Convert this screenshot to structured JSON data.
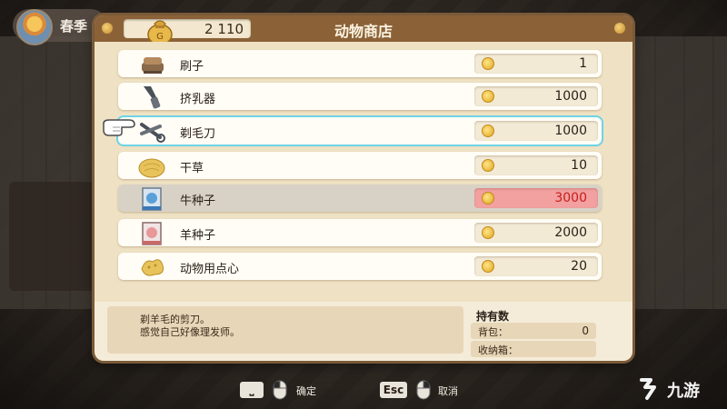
{
  "hud": {
    "season": "春季"
  },
  "shop": {
    "title": "动物商店",
    "money": "2 110",
    "items": [
      {
        "name": "刷子",
        "price": "1",
        "icon": "brush-icon"
      },
      {
        "name": "挤乳器",
        "price": "1000",
        "icon": "milker-icon"
      },
      {
        "name": "剃毛刀",
        "price": "1000",
        "icon": "shears-icon"
      },
      {
        "name": "干草",
        "price": "10",
        "icon": "hay-icon"
      },
      {
        "name": "牛种子",
        "price": "3000",
        "icon": "cow-seed-icon"
      },
      {
        "name": "羊种子",
        "price": "2000",
        "icon": "sheep-seed-icon"
      },
      {
        "name": "动物用点心",
        "price": "20",
        "icon": "animal-treat-icon"
      }
    ],
    "selected_item": "剃毛刀",
    "unaffordable_item": "牛种子",
    "description": [
      "剃羊毛的剪刀。",
      "感觉自己好像理发师。"
    ],
    "owned": {
      "title": "持有数",
      "backpack_label": "背包：",
      "backpack_value": "0",
      "storage_label": "收纳箱：",
      "storage_value": ""
    }
  },
  "controls": {
    "confirm_key": "⎵",
    "confirm_label": "确定",
    "cancel_key": "Esc",
    "cancel_label": "取消"
  },
  "watermark": "九游",
  "colors": {
    "header": "#8b6238",
    "selected_outline": "#6fd3e6",
    "unaffordable_bg": "#f2a0a0",
    "unaffordable_text": "#c81d1d"
  }
}
